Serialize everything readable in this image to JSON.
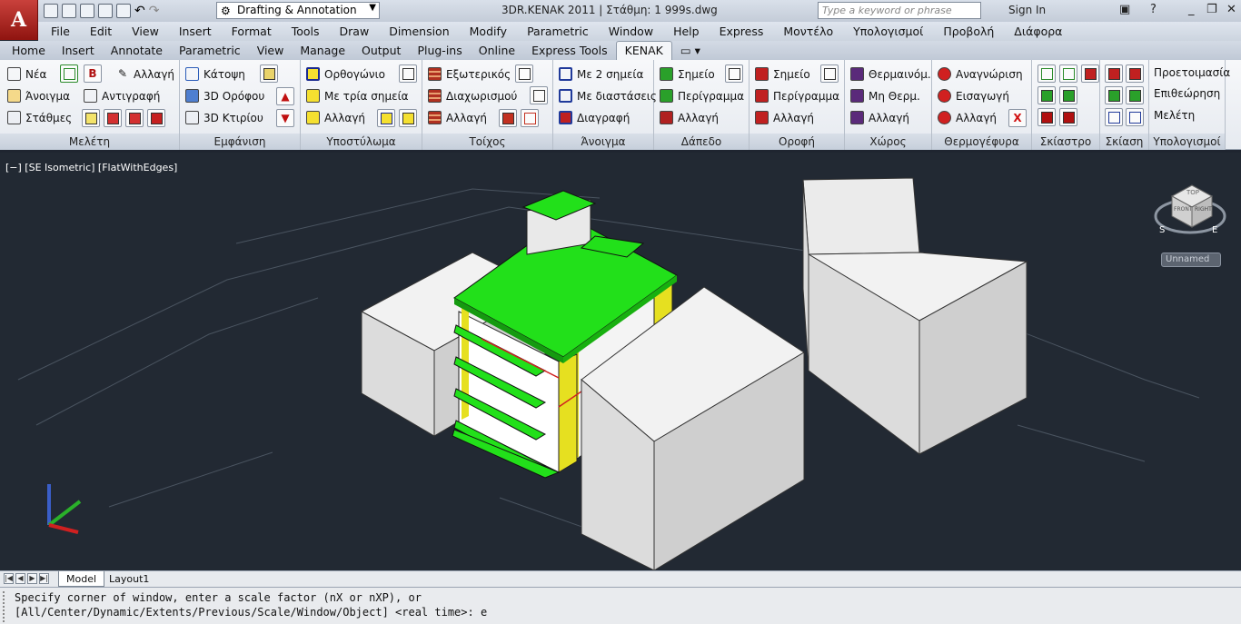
{
  "app": {
    "logo": "A",
    "title": "3DR.KENAK 2011  | Στάθμη: 1    999s.dwg"
  },
  "workspace": {
    "value": "Drafting & Annotation"
  },
  "search": {
    "placeholder": "Type a keyword or phrase"
  },
  "account": {
    "signin": "Sign In"
  },
  "menu": [
    "File",
    "Edit",
    "View",
    "Insert",
    "Format",
    "Tools",
    "Draw",
    "Dimension",
    "Modify",
    "Parametric",
    "Window",
    "Help",
    "Express",
    "Μοντέλο",
    "Υπολογισμοί",
    "Προβολή",
    "Διάφορα"
  ],
  "tabs": [
    "Home",
    "Insert",
    "Annotate",
    "Parametric",
    "View",
    "Manage",
    "Output",
    "Plug-ins",
    "Online",
    "Express Tools",
    "KENAK"
  ],
  "active_tab": "KENAK",
  "panels": {
    "meleti": {
      "title": "Μελέτη",
      "new": "Νέα",
      "open": "Άνοιγμα",
      "levels": "Στάθμες",
      "change": "Αλλαγή",
      "copy": "Αντιγραφή"
    },
    "emfanisi": {
      "title": "Εμφάνιση",
      "plan": "Κάτοψη",
      "floor3d": "3D Ορόφου",
      "building3d": "3D Κτιρίου"
    },
    "ypostyloma": {
      "title": "Υποστύλωμα",
      "rect": "Ορθογώνιο",
      "three": "Με τρία σημεία",
      "change": "Αλλαγή"
    },
    "toixos": {
      "title": "Τοίχος",
      "ext": "Εξωτερικός",
      "part": "Διαχωρισμού",
      "change": "Αλλαγή"
    },
    "anoigma": {
      "title": "Άνοιγμα",
      "two": "Με 2 σημεία",
      "dims": "Με διαστάσεις",
      "del": "Διαγραφή"
    },
    "dapedo": {
      "title": "Δάπεδο",
      "point": "Σημείο",
      "outline": "Περίγραμμα",
      "change": "Αλλαγή"
    },
    "orofi": {
      "title": "Οροφή",
      "point": "Σημείο",
      "outline": "Περίγραμμα",
      "change": "Αλλαγή"
    },
    "xoros": {
      "title": "Χώρος",
      "heated": "Θερμαινόμ.",
      "unheated": "Μη Θερμ.",
      "change": "Αλλαγή"
    },
    "thermo": {
      "title": "Θερμογέφυρα",
      "recog": "Αναγνώριση",
      "insert": "Εισαγωγή",
      "change": "Αλλαγή"
    },
    "skiastro": {
      "title": "Σκίαστρο"
    },
    "skiasi": {
      "title": "Σκίαση"
    },
    "ypologismoi": {
      "title": "Υπολογισμοί",
      "prep": "Προετοιμασία",
      "review": "Επιθεώρηση",
      "study": "Μελέτη"
    }
  },
  "viewport": {
    "label": "[−] [SE Isometric] [FlatWithEdges]",
    "ucs_menu": "Unnamed",
    "compass": {
      "s": "S",
      "e": "E"
    },
    "viewcube": {
      "top": "TOP",
      "front": "FRONT",
      "right": "RIGHT"
    }
  },
  "layouts": [
    "Model",
    "Layout1"
  ],
  "command": {
    "line1": "Specify corner of window, enter a scale factor (nX or nXP), or",
    "line2": "[All/Center/Dynamic/Extents/Previous/Scale/Window/Object] <real time>: e"
  },
  "colors": {
    "accent_green": "#22e01a",
    "wall_yellow": "#e6e020",
    "block_grey": "#e3e3e3",
    "bg": "#222933"
  }
}
